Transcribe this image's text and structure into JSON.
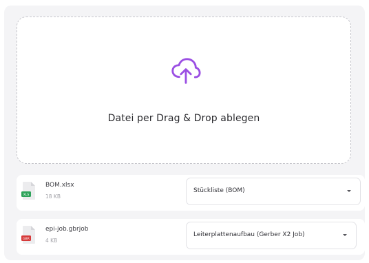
{
  "dropzone": {
    "text": "Datei per Drag & Drop ablegen",
    "icon": "cloud-upload-icon",
    "accent_color": "#9b4fe3"
  },
  "files": [
    {
      "name": "BOM.xlsx",
      "size": "18 KB",
      "icon": "excel-file-icon",
      "badge": "XLS",
      "badge_color": "#2ea35a",
      "type_selected": "Stückliste (BOM)"
    },
    {
      "name": "epi-job.gbrjob",
      "size": "4 KB",
      "icon": "gerber-file-icon",
      "badge": "GBR",
      "badge_color": "#d63a3a",
      "type_selected": "Leiterplattenaufbau (Gerber X2 Job)"
    }
  ]
}
